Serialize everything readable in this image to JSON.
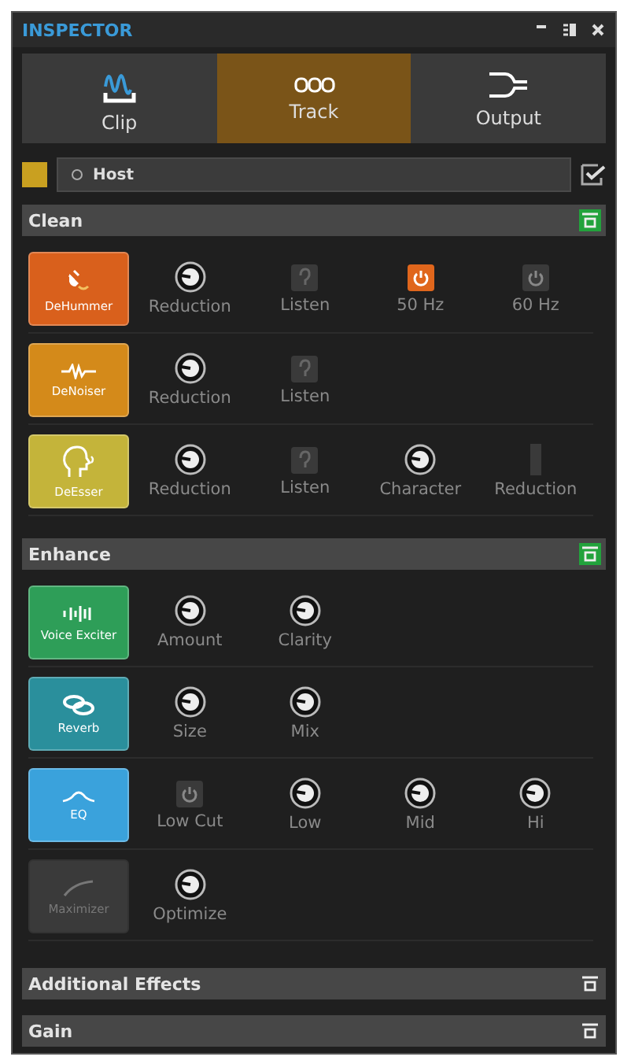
{
  "window": {
    "title": "INSPECTOR"
  },
  "tabs": [
    {
      "label": "Clip",
      "kind": "clip",
      "selected": false
    },
    {
      "label": "Track",
      "kind": "track",
      "selected": true
    },
    {
      "label": "Output",
      "kind": "output",
      "selected": false
    }
  ],
  "host": {
    "color": "#c9a020",
    "value": "Host"
  },
  "sections": [
    {
      "title": "Clean",
      "active": true,
      "modules": [
        {
          "name": "DeHummer",
          "kind": "plug",
          "color": "#d9601c",
          "on": true,
          "controls": [
            {
              "kind": "knob",
              "label": "Reduction"
            },
            {
              "kind": "listen",
              "label": "Listen",
              "on": false
            },
            {
              "kind": "power",
              "label": "50 Hz",
              "on": true
            },
            {
              "kind": "power",
              "label": "60 Hz",
              "on": false
            }
          ]
        },
        {
          "name": "DeNoiser",
          "kind": "wave",
          "color": "#d48a1a",
          "on": true,
          "controls": [
            {
              "kind": "knob",
              "label": "Reduction"
            },
            {
              "kind": "listen",
              "label": "Listen",
              "on": false
            }
          ]
        },
        {
          "name": "DeEsser",
          "kind": "head",
          "color": "#c4b43a",
          "on": true,
          "controls": [
            {
              "kind": "knob",
              "label": "Reduction"
            },
            {
              "kind": "listen",
              "label": "Listen",
              "on": false
            },
            {
              "kind": "knob",
              "label": "Character"
            },
            {
              "kind": "meter",
              "label": "Reduction"
            }
          ]
        }
      ]
    },
    {
      "title": "Enhance",
      "active": true,
      "modules": [
        {
          "name": "Voice Exciter",
          "kind": "bars",
          "color": "#2e9e58",
          "on": true,
          "controls": [
            {
              "kind": "knob",
              "label": "Amount"
            },
            {
              "kind": "knob",
              "label": "Clarity"
            }
          ]
        },
        {
          "name": "Reverb",
          "kind": "rings",
          "color": "#2a8f9c",
          "on": true,
          "controls": [
            {
              "kind": "knob",
              "label": "Size"
            },
            {
              "kind": "knob",
              "label": "Mix"
            }
          ]
        },
        {
          "name": "EQ",
          "kind": "curve",
          "color": "#3aa2dc",
          "on": true,
          "controls": [
            {
              "kind": "power",
              "label": "Low Cut",
              "on": false
            },
            {
              "kind": "knob",
              "label": "Low"
            },
            {
              "kind": "knob",
              "label": "Mid"
            },
            {
              "kind": "knob",
              "label": "Hi"
            }
          ]
        },
        {
          "name": "Maximizer",
          "kind": "line",
          "color": "#3a3a3a",
          "on": false,
          "controls": [
            {
              "kind": "knob",
              "label": "Optimize"
            }
          ]
        }
      ]
    },
    {
      "title": "Additional Effects",
      "active": false
    },
    {
      "title": "Gain",
      "active": false
    }
  ]
}
